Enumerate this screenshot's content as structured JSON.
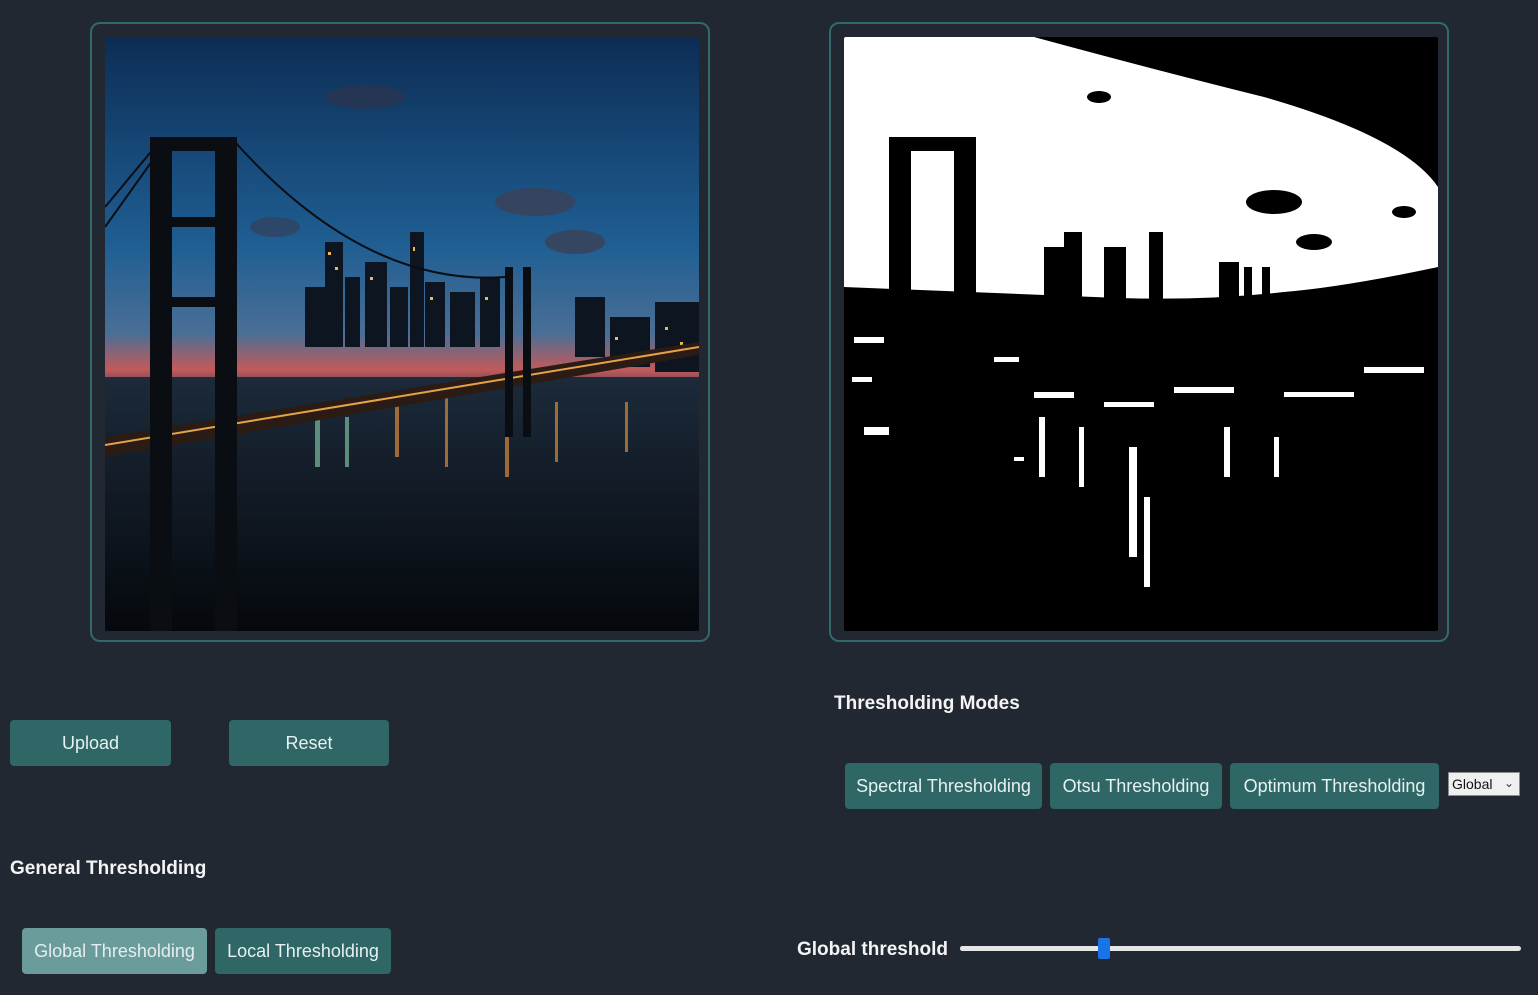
{
  "input_panel": {
    "image_description_icon": "photo-icon"
  },
  "output_panel": {
    "image_description_icon": "photo-icon"
  },
  "buttons": {
    "upload": "Upload",
    "reset": "Reset"
  },
  "thresholding_modes": {
    "heading": "Thresholding Modes",
    "spectral": "Spectral Thresholding",
    "otsu": "Otsu Thresholding",
    "optimum": "Optimum Thresholding",
    "scope_select": {
      "value": "Global"
    }
  },
  "general_thresholding": {
    "heading": "General Thresholding",
    "global": "Global Thresholding",
    "local": "Local Thresholding",
    "active": "global"
  },
  "global_threshold": {
    "label": "Global threshold",
    "fraction": 0.257
  },
  "colors": {
    "background": "#212832",
    "accent": "#2f6666",
    "accent_active": "#6a9c9c",
    "frame_border": "#2f6b6b",
    "slider_thumb": "#1a73e8"
  }
}
